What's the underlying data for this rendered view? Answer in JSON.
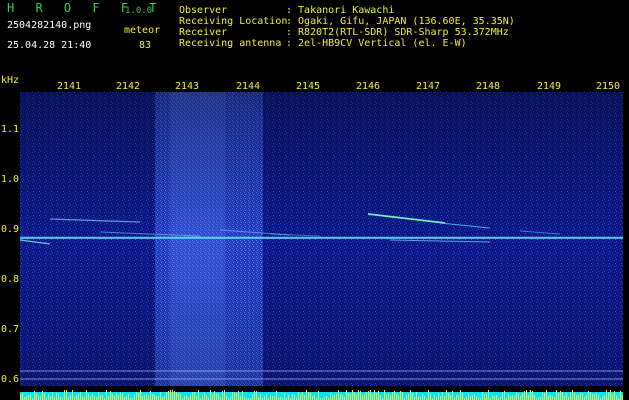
{
  "header": {
    "app_name": "H R O F F T",
    "version": "1.0.0",
    "filename": "2504282140.png",
    "datetime": "25.04.28 21:40",
    "mode": "meteor",
    "count": "83"
  },
  "meta": [
    {
      "label": "Observer",
      "value": ": Takanori Kawachi"
    },
    {
      "label": "Receiving Location",
      "value": ": Ogaki, Gifu, JAPAN (136.60E, 35.35N)"
    },
    {
      "label": "Receiver",
      "value": ": R820T2(RTL-SDR) SDR-Sharp 53.372MHz"
    },
    {
      "label": "Receiving antenna",
      "value": ": 2el-HB9CV Vertical (el. E-W)"
    }
  ],
  "axes": {
    "y_unit": "kHz",
    "x_ticks": [
      "2141",
      "2142",
      "2143",
      "2144",
      "2145",
      "2146",
      "2147",
      "2148",
      "2149",
      "2150"
    ],
    "y_ticks": [
      "1.1",
      "1.0",
      "0.9",
      "0.8",
      "0.7",
      "0.6"
    ]
  },
  "colors": {
    "background": "#000000",
    "text_header": "#ffffff",
    "text_label": "#f2ee30",
    "title": "#35d04a",
    "spectro_base": "#0a1a8a",
    "carrier": "#5fe0ff",
    "bottom_bar_cyan": "#00e8ff",
    "bottom_bar_yellow": "#f2ee30"
  }
}
